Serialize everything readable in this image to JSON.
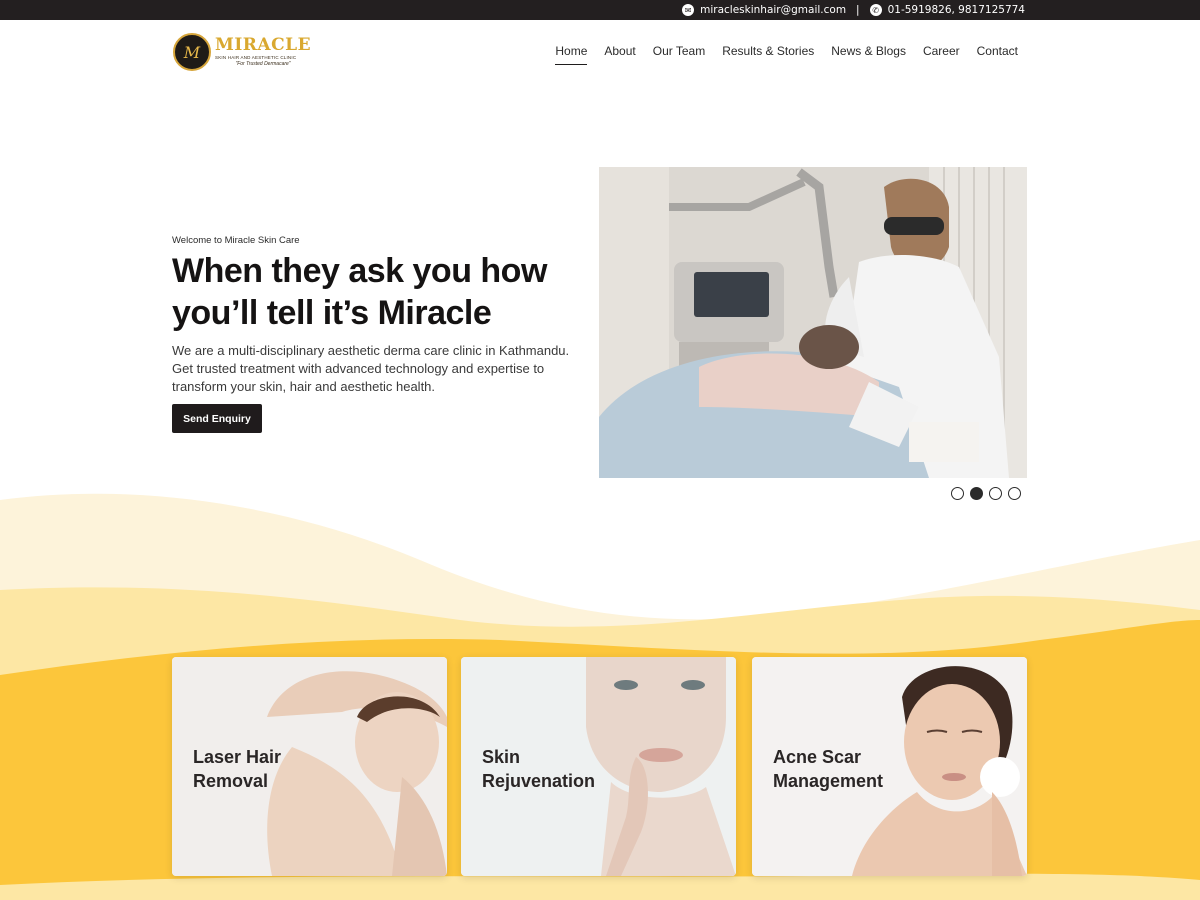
{
  "topbar": {
    "email": "miracleskinhair@gmail.com",
    "separator": "|",
    "phone": "01-5919826, 9817125774",
    "email_icon": "mail-icon",
    "phone_icon": "phone-icon"
  },
  "logo": {
    "monogram": "M",
    "brand": "MIRACLE",
    "subtitle": "SKIN HAIR AND AESTHETIC CLINIC",
    "tagline": "\"For Trusted Dermacare\""
  },
  "nav": {
    "items": [
      {
        "label": "Home"
      },
      {
        "label": "About"
      },
      {
        "label": "Our Team"
      },
      {
        "label": "Results & Stories"
      },
      {
        "label": "News & Blogs"
      },
      {
        "label": "Career"
      },
      {
        "label": "Contact"
      }
    ],
    "active": "Home"
  },
  "hero": {
    "eyebrow": "Welcome to Miracle Skin Care",
    "title": "When they ask you how you’ll tell it’s Miracle",
    "description": "We are a multi-disciplinary aesthetic derma care clinic in Kathmandu. Get trusted treatment with advanced technology and expertise to transform your skin, hair and aesthetic health.",
    "button": "Send Enquiry",
    "slide_count": 4,
    "active_slide": 2
  },
  "services": [
    {
      "label": "Laser Hair Removal"
    },
    {
      "label": "Skin Rejuvenation"
    },
    {
      "label": "Acne Scar Management"
    }
  ],
  "colors": {
    "accent": "#fcc63b",
    "dark": "#231f20",
    "wave_light": "#fdf3da",
    "wave_mid": "#fde7a4"
  }
}
